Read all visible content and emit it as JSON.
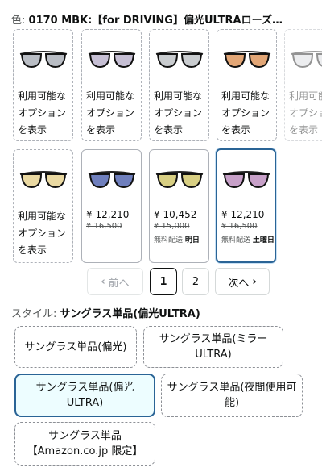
{
  "color": {
    "label": "色:",
    "value": "0170 MBK:【for DRIVING】偏光ULTRAローズ…"
  },
  "swatches_row1": [
    {
      "lens": "#b9bdc4",
      "text": [
        "利用可能な",
        "オプション",
        "を表示"
      ]
    },
    {
      "lens": "#c6bfd4",
      "text": [
        "利用可能な",
        "オプション",
        "を表示"
      ]
    },
    {
      "lens": "#c9cccf",
      "text": [
        "利用可能な",
        "オプション",
        "を表示"
      ]
    },
    {
      "lens": "#e2a676",
      "text": [
        "利用可能な",
        "オプション",
        "を表示"
      ]
    },
    {
      "lens": "#d6d8dc",
      "text": [
        "利用可能な",
        "オプション",
        "を表示"
      ]
    }
  ],
  "swatches_row2": [
    {
      "lens": "#ead9a2",
      "text": [
        "利用可能な",
        "オプション",
        "を表示"
      ]
    },
    {
      "lens": "#6f7fbd",
      "price": "¥ 12,210",
      "list_price": "¥ 16,500",
      "ship_label": "",
      "ship_day": ""
    },
    {
      "lens": "#d8cf83",
      "price": "¥ 10,452",
      "list_price": "¥ 15,000",
      "ship_label": "無料配送",
      "ship_day": "明日"
    },
    {
      "lens": "#c7a0c8",
      "price": "¥ 12,210",
      "list_price": "¥ 16,500",
      "ship_label": "無料配送",
      "ship_day": "土曜日"
    }
  ],
  "pager": {
    "prev": "前へ",
    "pages": [
      "1",
      "2"
    ],
    "current": "1",
    "next": "次へ"
  },
  "style": {
    "label": "スタイル:",
    "value": "サングラス単品(偏光ULTRA)",
    "options": [
      "サングラス単品(偏光)",
      "サングラス単品(ミラーULTRA)",
      "サングラス単品(偏光ULTRA)",
      "サングラス単品(夜間使用可能)",
      "サングラス単品【Amazon.co.jp 限定】"
    ]
  },
  "colors": {
    "accent": "#2a6496",
    "border": "#adb1b8",
    "muted": "#565959"
  }
}
